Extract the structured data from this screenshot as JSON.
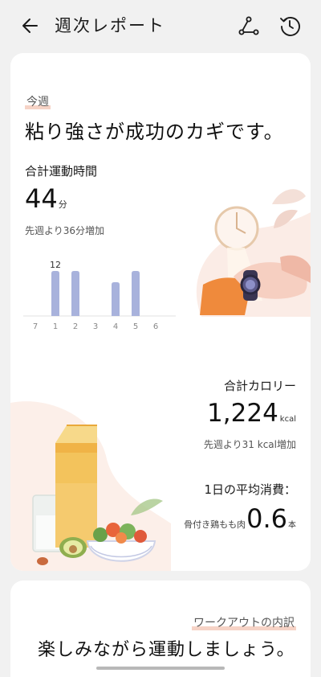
{
  "header": {
    "title": "週次レポート"
  },
  "summary": {
    "period_label": "今週",
    "headline": "粘り強さが成功のカギです。",
    "exercise_label": "合計運動時間",
    "exercise_value": "44",
    "exercise_unit": "分",
    "exercise_compare": "先週より36分増加"
  },
  "chart_data": {
    "type": "bar",
    "categories": [
      "7",
      "1",
      "2",
      "3",
      "4",
      "5",
      "6"
    ],
    "values": [
      0,
      12,
      12,
      0,
      9,
      12,
      0
    ],
    "data_labels": [
      "",
      "12",
      "",
      "",
      "",
      "",
      ""
    ],
    "bar_color": "#a8b2dc"
  },
  "calories": {
    "label": "合計カロリー",
    "value": "1,224",
    "unit": "kcal",
    "compare": "先週より31 kcal増加"
  },
  "average": {
    "label": "1日の平均消費：",
    "item": "骨付き鶏もも肉",
    "value": "0.6",
    "unit": "本"
  },
  "workout": {
    "label": "ワークアウトの内訳",
    "headline": "楽しみながら運動しましょう。"
  },
  "colors": {
    "accent_underline": "#f6d3c6",
    "background": "#f1f1f1",
    "card": "#ffffff"
  }
}
